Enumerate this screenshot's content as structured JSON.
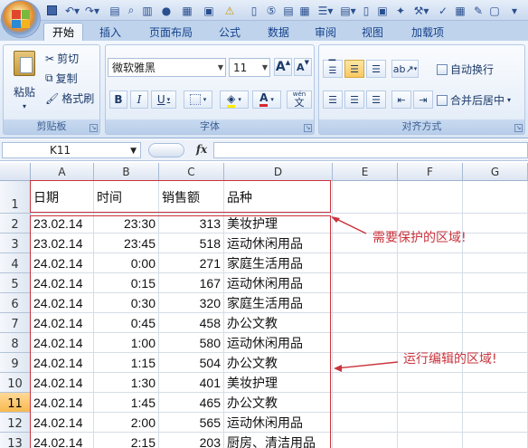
{
  "ribbon_tabs": [
    "开始",
    "插入",
    "页面布局",
    "公式",
    "数据",
    "审阅",
    "视图",
    "加载项"
  ],
  "clipboard": {
    "paste_label": "粘贴",
    "cut_label": "剪切",
    "copy_label": "复制",
    "format_painter_label": "格式刷",
    "group_label": "剪贴板"
  },
  "font": {
    "family": "微软雅黑",
    "size": "11",
    "grow_label": "A",
    "shrink_label": "A",
    "bold_label": "B",
    "italic_label": "I",
    "underline_label": "U",
    "font_color_label": "A",
    "phonetic_label": "文",
    "phonetic_top_label": "wén",
    "group_label": "字体"
  },
  "alignment": {
    "wrap_text_label": "自动换行",
    "merge_center_label": "合并后居中",
    "group_label": "对齐方式"
  },
  "formula_bar": {
    "name_box": "K11",
    "fx_label": "fx",
    "formula": ""
  },
  "columns": [
    "A",
    "B",
    "C",
    "D",
    "E",
    "F",
    "G"
  ],
  "rows": [
    "1",
    "2",
    "3",
    "4",
    "5",
    "6",
    "7",
    "8",
    "9",
    "10",
    "11",
    "12",
    "13"
  ],
  "selected_row": "11",
  "headers": [
    "日期",
    "时间",
    "销售额",
    "品种"
  ],
  "data_rows": [
    [
      "23.02.14",
      "23:30",
      "313",
      "美妆护理"
    ],
    [
      "23.02.14",
      "23:45",
      "518",
      "运动休闲用品"
    ],
    [
      "24.02.14",
      "0:00",
      "271",
      "家庭生活用品"
    ],
    [
      "24.02.14",
      "0:15",
      "167",
      "运动休闲用品"
    ],
    [
      "24.02.14",
      "0:30",
      "320",
      "家庭生活用品"
    ],
    [
      "24.02.14",
      "0:45",
      "458",
      "办公文教"
    ],
    [
      "24.02.14",
      "1:00",
      "580",
      "运动休闲用品"
    ],
    [
      "24.02.14",
      "1:15",
      "504",
      "办公文教"
    ],
    [
      "24.02.14",
      "1:30",
      "401",
      "美妆护理"
    ],
    [
      "24.02.14",
      "1:45",
      "465",
      "办公文教"
    ],
    [
      "24.02.14",
      "2:00",
      "565",
      "运动休闲用品"
    ],
    [
      "24.02.14",
      "2:15",
      "203",
      "厨房、清洁用品"
    ]
  ],
  "annotations": {
    "protected_label": "需要保护的区域!",
    "editable_label": "运行编辑的区域!"
  },
  "colors": {
    "annotation_red": "#c9343d",
    "selected_row_header": "#f7b94e",
    "ribbon_blue": "#dae6f5"
  }
}
